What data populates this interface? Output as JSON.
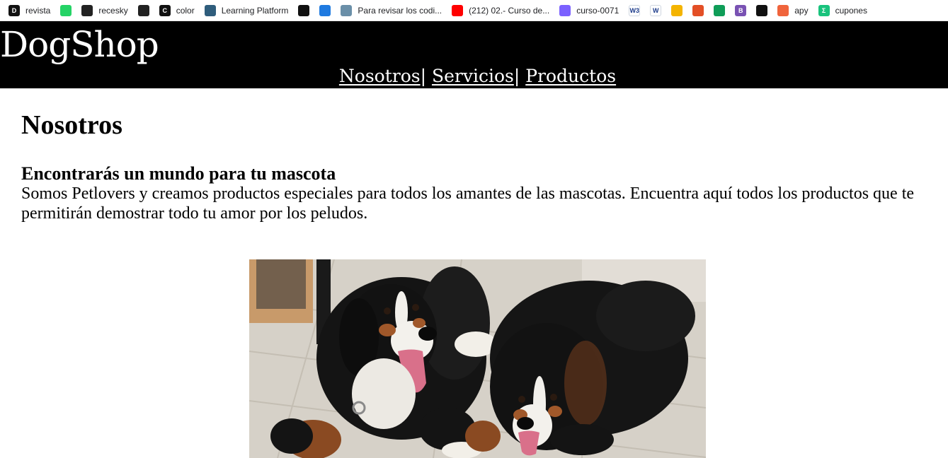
{
  "bookmarks": [
    {
      "label": "revista",
      "icon": "d-icon",
      "color": "#111111",
      "glyph": "D"
    },
    {
      "label": "",
      "icon": "whatsapp-icon",
      "color": "#25d366",
      "glyph": ""
    },
    {
      "label": "recesky",
      "icon": "camera-icon",
      "color": "#222222",
      "glyph": ""
    },
    {
      "label": "",
      "icon": "camera-icon",
      "color": "#222222",
      "glyph": ""
    },
    {
      "label": "color",
      "icon": "color-icon",
      "color": "#111111",
      "glyph": "C"
    },
    {
      "label": "Learning Platform",
      "icon": "learning-icon",
      "color": "#2f5d7c",
      "glyph": ""
    },
    {
      "label": "",
      "icon": "github-icon",
      "color": "#111111",
      "glyph": ""
    },
    {
      "label": "",
      "icon": "power-icon",
      "color": "#1f7ae0",
      "glyph": ""
    },
    {
      "label": "Para revisar los codi...",
      "icon": "page-icon",
      "color": "#6a8fa8",
      "glyph": ""
    },
    {
      "label": "(212) 02.- Curso de...",
      "icon": "youtube-icon",
      "color": "#ff0000",
      "glyph": ""
    },
    {
      "label": "curso-0071",
      "icon": "chrome-icon",
      "color": "#7b61ff",
      "glyph": ""
    },
    {
      "label": "",
      "icon": "w3-icon",
      "color": "#ffffff",
      "glyph": "W3"
    },
    {
      "label": "",
      "icon": "w-icon",
      "color": "#ffffff",
      "glyph": "W"
    },
    {
      "label": "",
      "icon": "drive-icon",
      "color": "#f4b400",
      "glyph": ""
    },
    {
      "label": "",
      "icon": "html5-icon",
      "color": "#e34f26",
      "glyph": ""
    },
    {
      "label": "",
      "icon": "drive-icon",
      "color": "#0f9d58",
      "glyph": ""
    },
    {
      "label": "",
      "icon": "bootstrap-icon",
      "color": "#7952b3",
      "glyph": "B"
    },
    {
      "label": "",
      "icon": "cat-icon",
      "color": "#111111",
      "glyph": ""
    },
    {
      "label": "apy",
      "icon": "octopus-icon",
      "color": "#f0643c",
      "glyph": ""
    },
    {
      "label": "cupones",
      "icon": "sigma-icon",
      "color": "#19c37d",
      "glyph": "Σ"
    }
  ],
  "header": {
    "logo": "DogShop",
    "nav": [
      {
        "label": "Nosotros"
      },
      {
        "label": "Servicios"
      },
      {
        "label": "Productos"
      }
    ],
    "separator": "|"
  },
  "main": {
    "title": "Nosotros",
    "subtitle": "Encontrarás un mundo para tu mascota",
    "intro": "Somos Petlovers y creamos productos especiales para todos los amantes de las mascotas. Encuentra aquí todos los productos que te permitirán demostrar todo tu amor por los peludos."
  },
  "hero": {
    "image_subject": "two-bernese-mountain-dogs"
  }
}
